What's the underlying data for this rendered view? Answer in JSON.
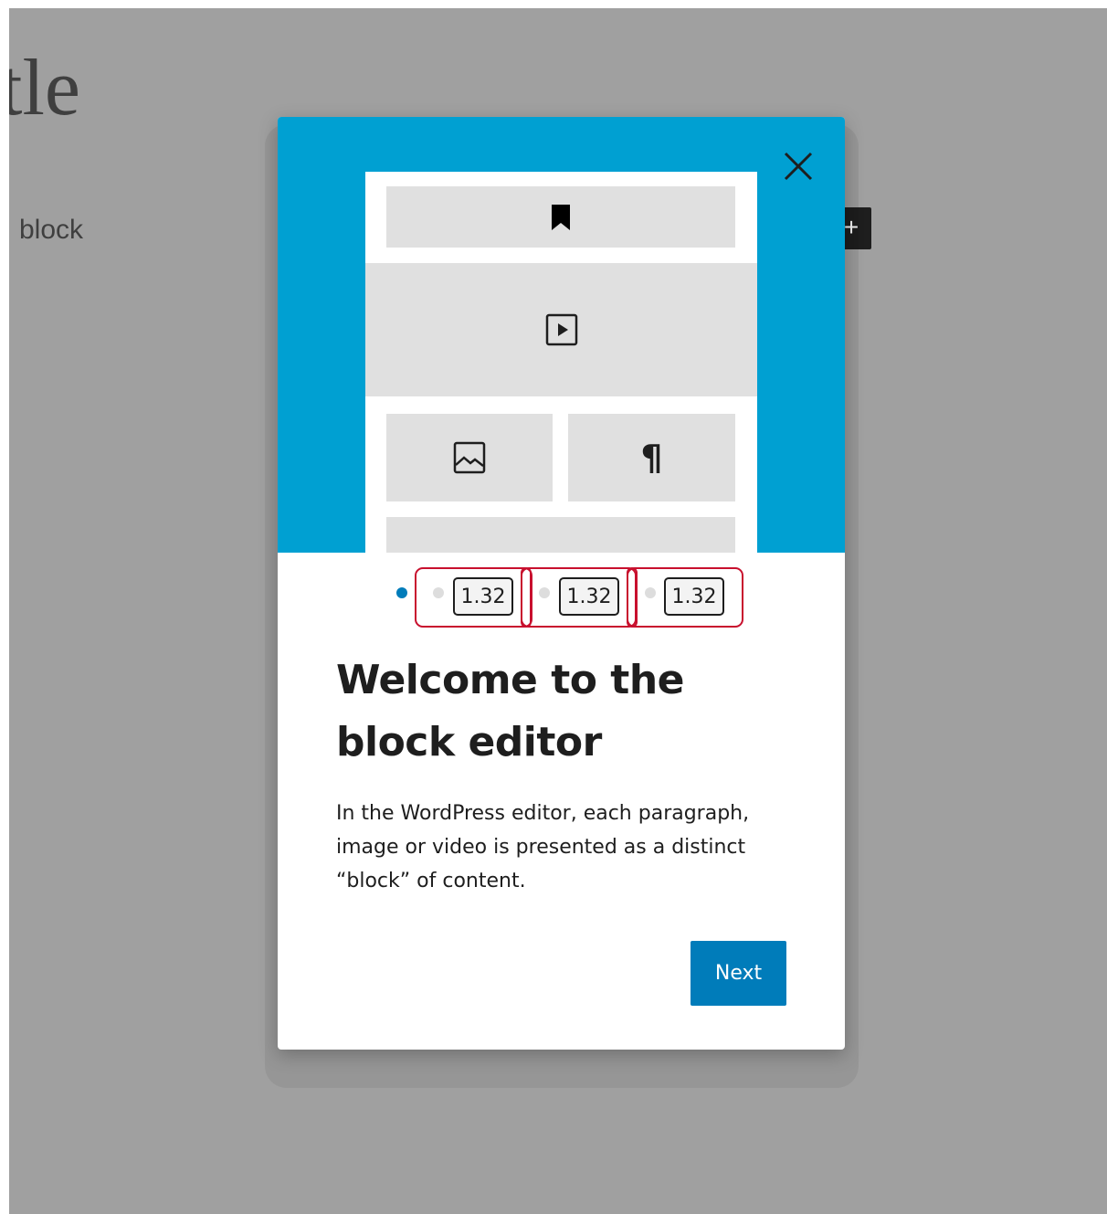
{
  "background": {
    "post_title_fragment": "tle",
    "block_placeholder_fragment": "block",
    "inserter_symbol": "+"
  },
  "modal": {
    "close_icon": "close-icon",
    "illustration": {
      "blocks": [
        {
          "icon": "bookmark-icon"
        },
        {
          "icon": "video-play-icon"
        },
        {
          "icon": "image-icon"
        },
        {
          "icon": "paragraph-icon",
          "glyph": "¶"
        },
        {
          "icon": "none"
        }
      ]
    },
    "pager": {
      "total_pages": 4,
      "current_page": 1,
      "page_labels": [
        "1.32",
        "1.32",
        "1.32"
      ]
    },
    "heading": "Welcome to the block editor",
    "body": "In the WordPress editor, each paragraph, image or video is presented as a distinct “block” of content.",
    "next_label": "Next"
  },
  "colors": {
    "hero_background": "#00a0d2",
    "primary_button": "#007cba",
    "active_dot": "#007cba",
    "inactive_dot": "#dddddd",
    "highlight_outline": "#c8102e",
    "backdrop": "#a0a0a0"
  }
}
